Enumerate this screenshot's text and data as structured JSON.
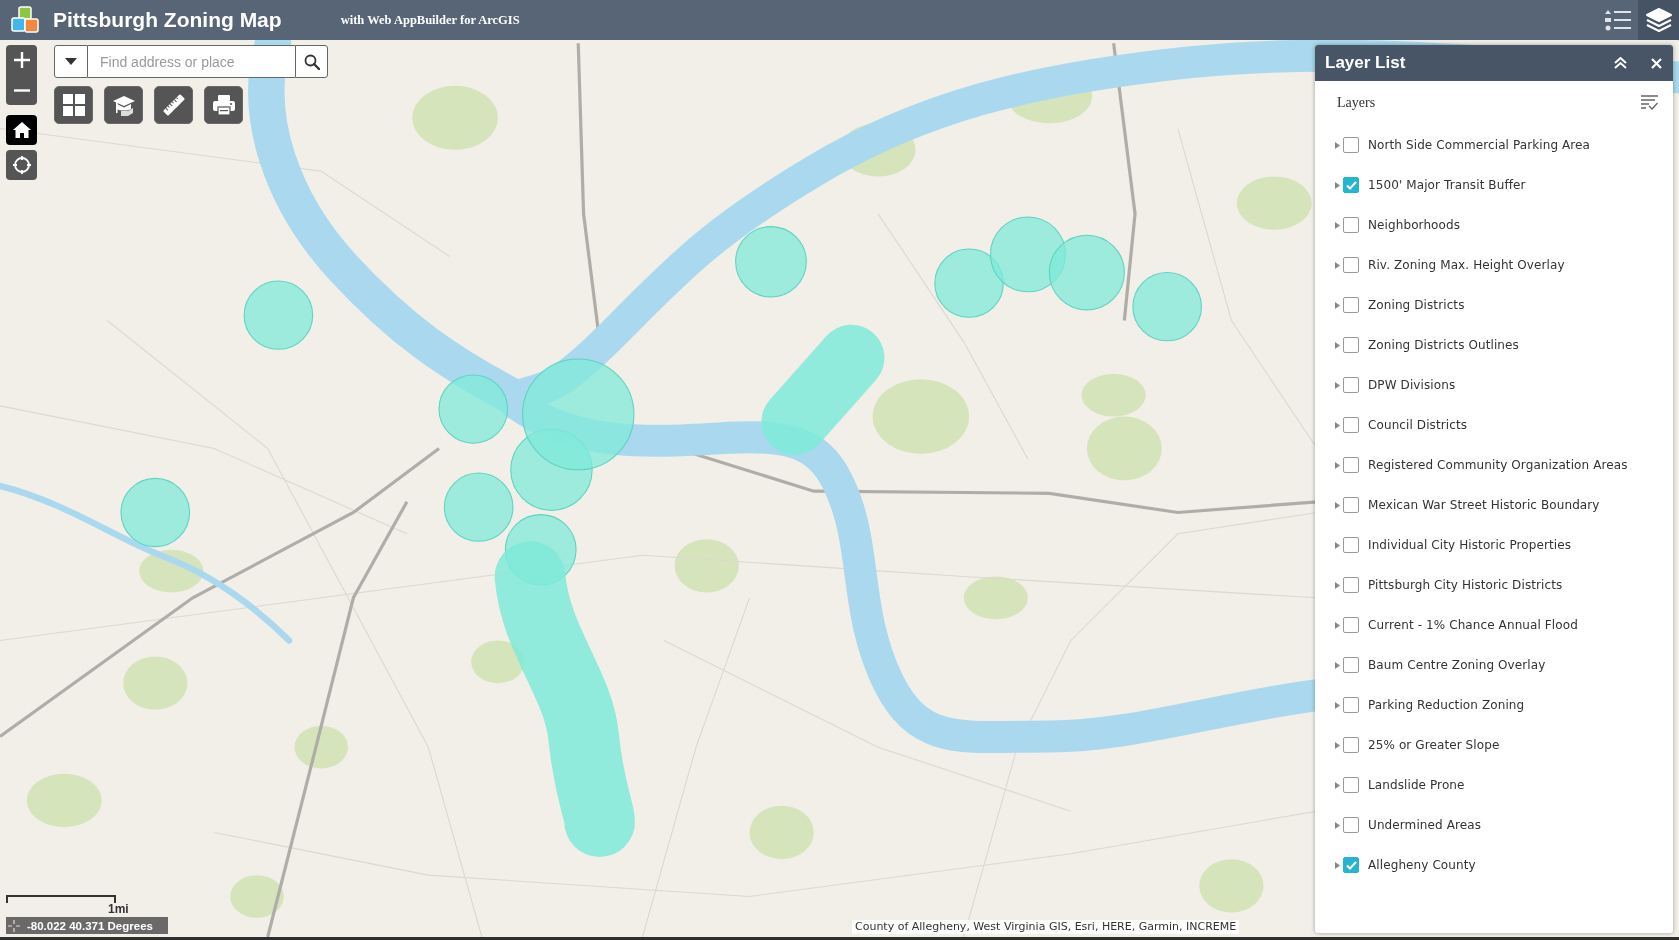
{
  "header": {
    "title": "Pittsburgh Zoning Map",
    "subtitle": "with Web AppBuilder for ArcGIS"
  },
  "header_tools": [
    {
      "selected": false
    },
    {
      "selected": true
    }
  ],
  "search": {
    "placeholder": "Find address or place"
  },
  "layer_list": {
    "title": "Layer List",
    "section_label": "Layers",
    "layers": [
      {
        "label": "North Side Commercial Parking Area",
        "checked": false,
        "expanded": false
      },
      {
        "label": "1500' Major Transit Buffer",
        "checked": true,
        "expanded": false
      },
      {
        "label": "Neighborhoods",
        "checked": false,
        "expanded": false
      },
      {
        "label": "Riv. Zoning Max. Height Overlay",
        "checked": false,
        "expanded": false
      },
      {
        "label": "Zoning Districts",
        "checked": false,
        "expanded": false
      },
      {
        "label": "Zoning Districts Outlines",
        "checked": false,
        "expanded": false
      },
      {
        "label": "DPW Divisions",
        "checked": false,
        "expanded": false
      },
      {
        "label": "Council Districts",
        "checked": false,
        "expanded": false
      },
      {
        "label": "Registered Community Organization Areas",
        "checked": false,
        "expanded": false
      },
      {
        "label": "Mexican War Street Historic Boundary",
        "checked": false,
        "expanded": false
      },
      {
        "label": "Individual City Historic Properties",
        "checked": false,
        "expanded": false
      },
      {
        "label": "Pittsburgh City Historic Districts",
        "checked": false,
        "expanded": false
      },
      {
        "label": "Current - 1% Chance Annual Flood",
        "checked": false,
        "expanded": false
      },
      {
        "label": "Baum Centre Zoning Overlay",
        "checked": false,
        "expanded": false
      },
      {
        "label": "Parking Reduction Zoning",
        "checked": false,
        "expanded": false
      },
      {
        "label": "25% or Greater Slope",
        "checked": false,
        "expanded": false
      },
      {
        "label": "Landslide Prone",
        "checked": false,
        "expanded": false
      },
      {
        "label": "Undermined Areas",
        "checked": false,
        "expanded": false
      },
      {
        "label": "Allegheny County",
        "checked": true,
        "expanded": false
      }
    ]
  },
  "scale_bar": {
    "label": "1mi"
  },
  "coordinates": {
    "text": "-80.022 40.371 Degrees"
  },
  "attribution": "County of Allegheny, West Virginia GIS, Esri, HERE, Garmin, INCREME"
}
